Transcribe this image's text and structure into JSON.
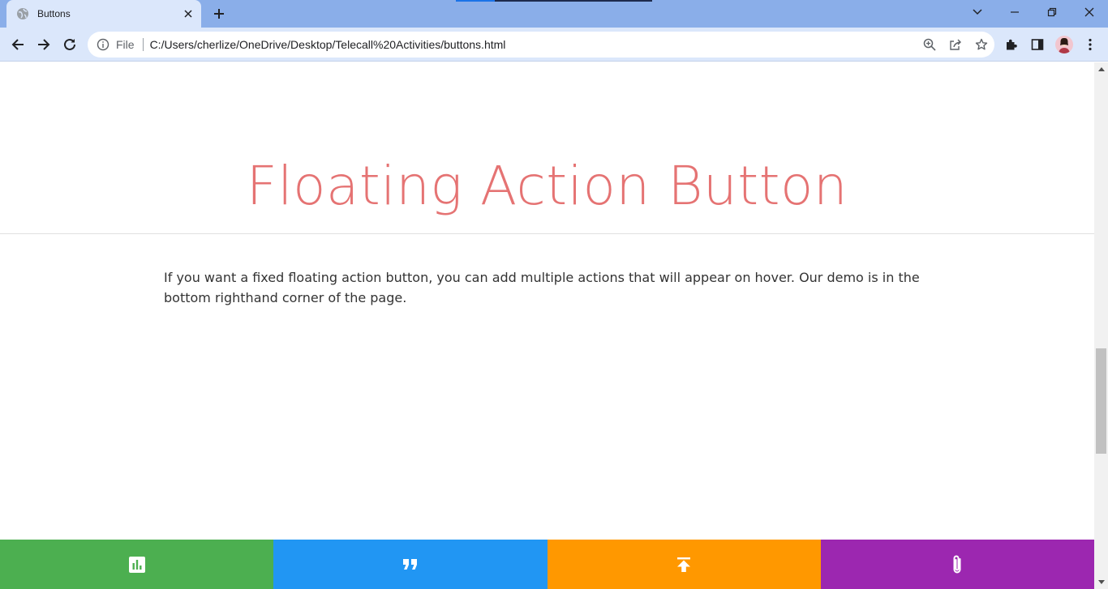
{
  "browser": {
    "tab_title": "Buttons",
    "address_scheme": "File",
    "address_url": "C:/Users/cherlize/OneDrive/Desktop/Telecall%20Activities/buttons.html"
  },
  "page": {
    "title": "Floating Action Button",
    "intro": "If you want a fixed floating action button, you can add multiple actions that will appear on hover. Our demo is in the bottom righthand corner of the page."
  },
  "fab_actions": [
    {
      "icon": "insert-chart-icon",
      "color": "#4caf50"
    },
    {
      "icon": "format-quote-icon",
      "color": "#2196f3"
    },
    {
      "icon": "publish-icon",
      "color": "#ff9800"
    },
    {
      "icon": "attach-file-icon",
      "color": "#9c27b0"
    }
  ],
  "theme": {
    "title_color": "#e57373",
    "tabstrip_color": "#8aaee9",
    "toolbar_color": "#dbe7fb"
  }
}
